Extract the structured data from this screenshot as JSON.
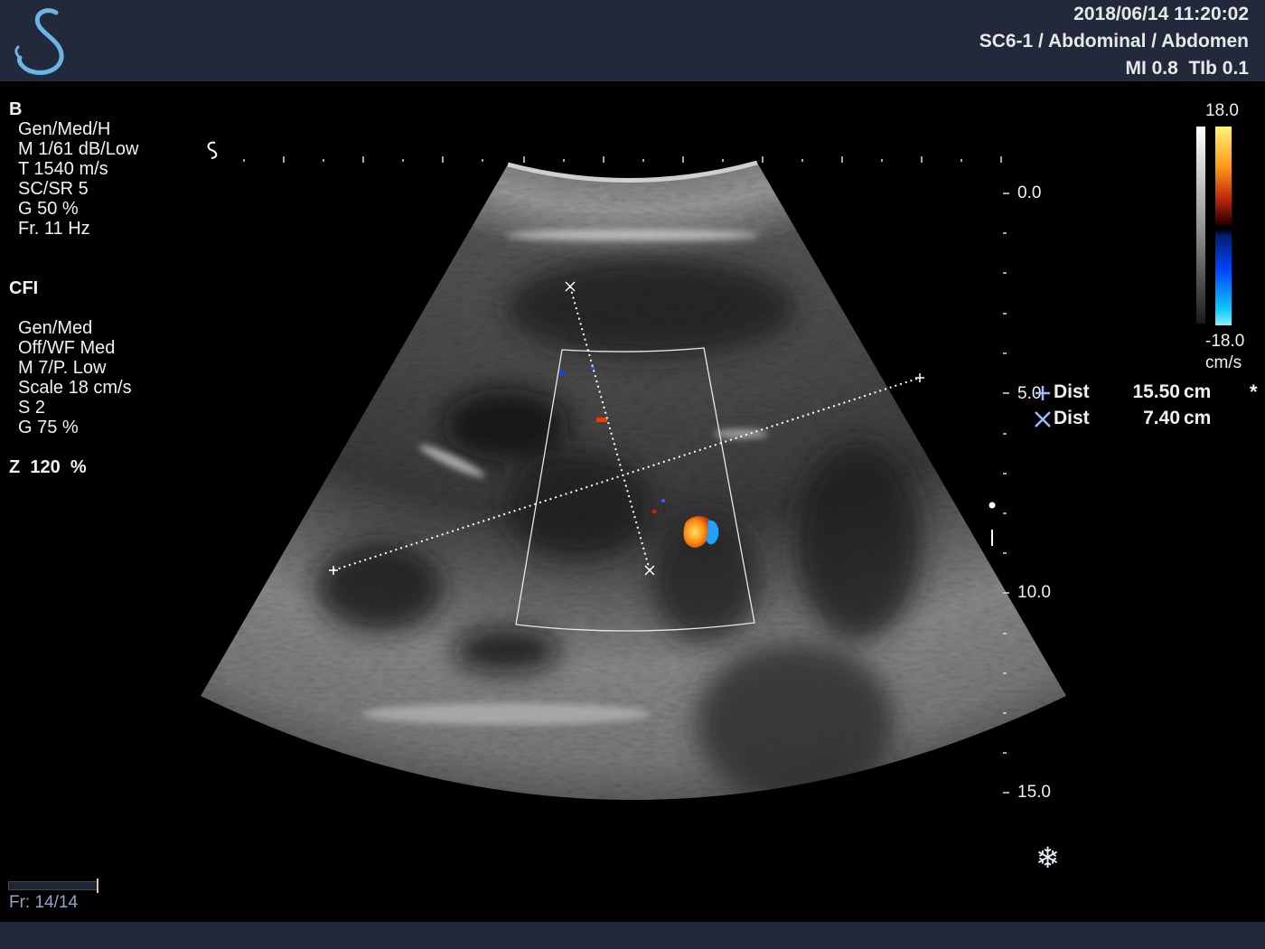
{
  "header": {
    "datetime": "2018/06/14 11:20:02",
    "probe_preset": "SC6-1 / Abdominal / Abdomen",
    "indices": "MI 0.8  TIb 0.1"
  },
  "b_mode": {
    "title": "B",
    "lines": [
      "Gen/Med/H",
      "M 1/61 dB/Low",
      "T 1540 m/s",
      "SC/SR 5",
      "G 50 %",
      "Fr. 11 Hz"
    ]
  },
  "cfi": {
    "title": "CFI",
    "lines": [
      "Gen/Med",
      "Off/WF Med",
      "M 7/P. Low",
      "Scale 18 cm/s",
      "S 2",
      "G 75 %"
    ]
  },
  "zoom": "Z  120  %",
  "colorbar": {
    "top": "18.0",
    "bottom": "-18.0",
    "unit": "cm/s"
  },
  "depth_scale": {
    "labels": [
      "0.0",
      "5.0",
      "10.0",
      "15.0"
    ]
  },
  "measurements": [
    {
      "symbol": "plus",
      "label": "Dist",
      "value": "15.50",
      "unit": "cm",
      "color": "#9ab8ff"
    },
    {
      "symbol": "cross",
      "label": "Dist",
      "value": "7.40",
      "unit": "cm",
      "color": "#9ab8ff"
    }
  ],
  "marker": "*",
  "freeze_icon": "snowflake-icon",
  "cine": {
    "frame_text": "Fr: 14/14",
    "progress": 1.0
  },
  "colors": {
    "panel": "#21293a",
    "logo": "#6ab4e8",
    "accent": "#9ab8ff"
  }
}
